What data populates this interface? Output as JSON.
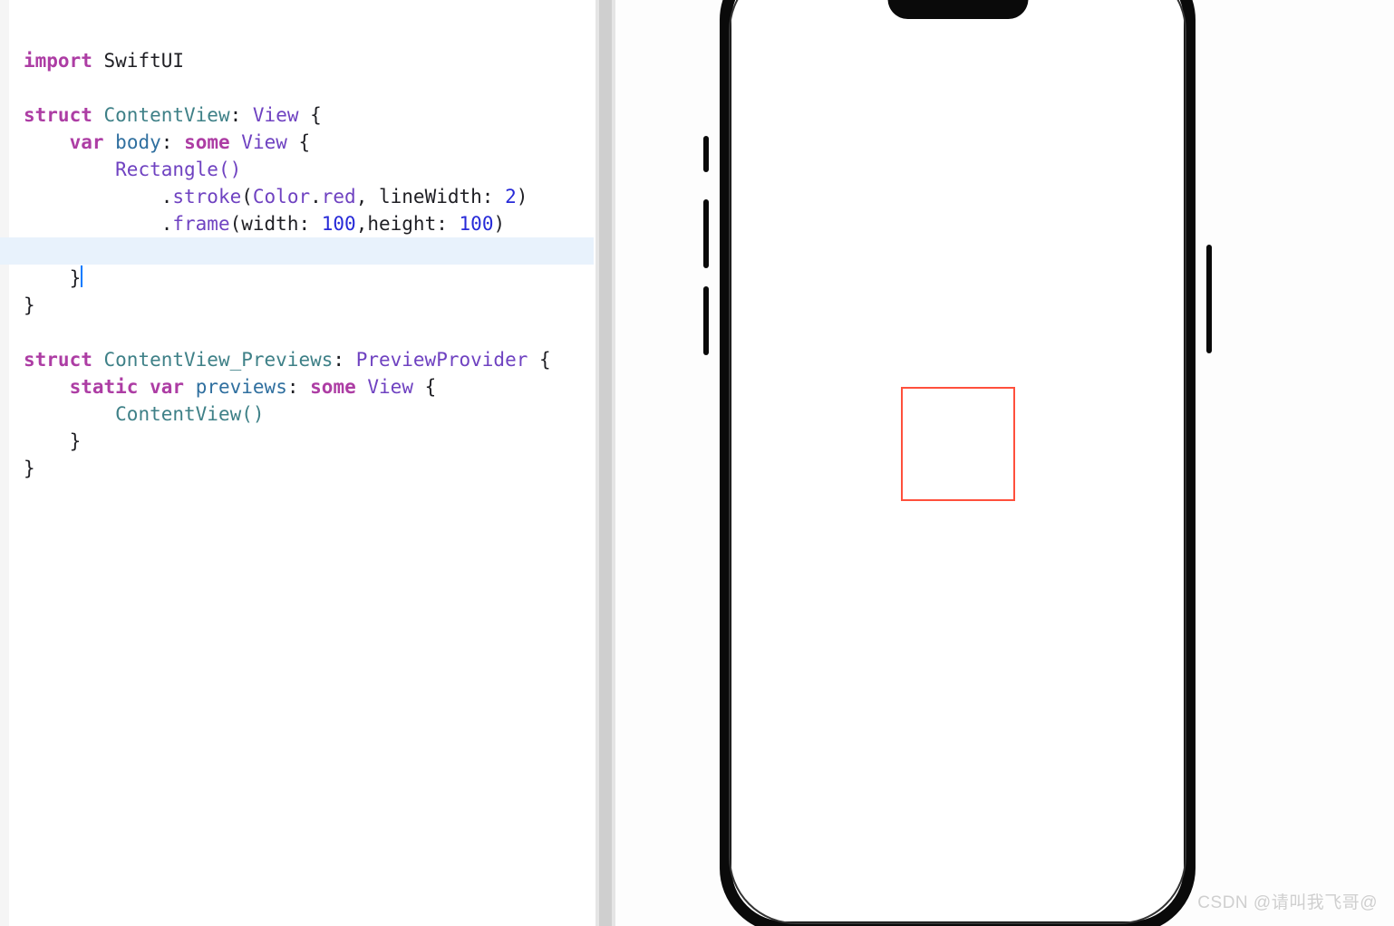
{
  "code": {
    "line1": {
      "import": "import",
      "module": "SwiftUI"
    },
    "line3": {
      "struct": "struct",
      "name": "ContentView",
      "colon": ":",
      "proto": "View",
      "brace": "{"
    },
    "line4": {
      "var": "var",
      "body": "body",
      "colon": ":",
      "some": "some",
      "view": "View",
      "brace": "{"
    },
    "line5": {
      "call": "Rectangle()"
    },
    "line6": {
      "dot": ".",
      "method": "stroke",
      "open": "(",
      "colorType": "Color",
      "dotRed": ".",
      "red": "red",
      "comma": ", ",
      "lwLabel": "lineWidth:",
      "lw": "2",
      "close": ")"
    },
    "line7": {
      "dot": ".",
      "method": "frame",
      "open": "(",
      "wLabel": "width:",
      "w": "100",
      "comma": ",",
      "hLabel": "height:",
      "h": "100",
      "close": ")"
    },
    "line9": {
      "brace": "}"
    },
    "line10": {
      "brace": "}"
    },
    "line12": {
      "struct": "struct",
      "name": "ContentView_Previews",
      "colon": ":",
      "proto": "PreviewProvider",
      "brace": "{"
    },
    "line13": {
      "static": "static",
      "var": "var",
      "previews": "previews",
      "colon": ":",
      "some": "some",
      "view": "View",
      "brace": "{"
    },
    "line14": {
      "call": "ContentView()"
    },
    "line15": {
      "brace": "}"
    },
    "line16": {
      "brace": "}"
    }
  },
  "preview": {
    "rect": {
      "width": 126,
      "height": 126,
      "borderColor": "#ff503c",
      "borderWidth": 2
    }
  },
  "watermark": "CSDN @请叫我飞哥@"
}
